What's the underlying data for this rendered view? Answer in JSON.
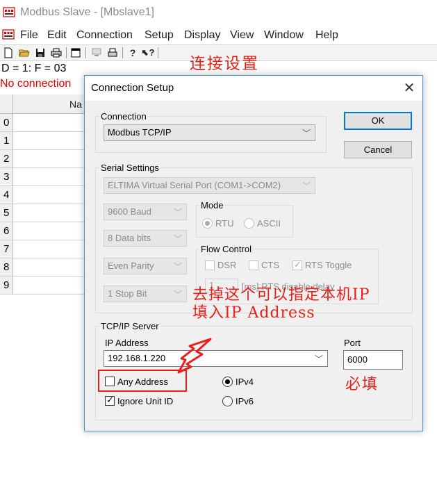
{
  "app": {
    "title": "Modbus Slave - [Mbslave1]",
    "menu": [
      "File",
      "Edit",
      "Connection",
      "Setup",
      "Display",
      "View",
      "Window",
      "Help"
    ],
    "toolbar_icons": [
      "new-icon",
      "open-icon",
      "save-icon",
      "print-icon",
      "window-icon",
      "monitor-icon",
      "printer2-icon",
      "help-icon",
      "context-help-icon"
    ],
    "status_line": "D = 1: F = 03",
    "no_connection": "No connection",
    "grid": {
      "column_header": "Na",
      "rows": [
        "0",
        "1",
        "2",
        "3",
        "4",
        "5",
        "6",
        "7",
        "8",
        "9"
      ]
    }
  },
  "annotations": {
    "title": "连接设置",
    "ip_note_line1": "去掉这个可以指定本机IP",
    "ip_note_line2": "填入IP Address",
    "port_note": "必填"
  },
  "dialog": {
    "title": "Connection Setup",
    "close_glyph": "✕",
    "buttons": {
      "ok": "OK",
      "cancel": "Cancel"
    },
    "connection": {
      "label": "Connection",
      "value": "Modbus TCP/IP"
    },
    "serial": {
      "label": "Serial Settings",
      "port": "ELTIMA Virtual Serial Port (COM1->COM2)",
      "baud": "9600 Baud",
      "data_bits": "8 Data bits",
      "parity": "Even Parity",
      "stop_bits": "1 Stop Bit",
      "mode": {
        "label": "Mode",
        "rtu": "RTU",
        "ascii": "ASCII",
        "selected": "RTU"
      },
      "flow": {
        "label": "Flow Control",
        "dsr": "DSR",
        "cts": "CTS",
        "rts_toggle": "RTS Toggle",
        "rts_toggle_checked": true,
        "rts_delay_value": "1",
        "rts_delay_label": "[ms] RTS disable delay"
      }
    },
    "tcp": {
      "label": "TCP/IP Server",
      "ip_label": "IP Address",
      "ip_value": "192.168.1.220",
      "port_label": "Port",
      "port_value": "6000",
      "any_address": "Any Address",
      "any_address_checked": false,
      "ignore_unit_id": "Ignore Unit ID",
      "ignore_unit_id_checked": true,
      "ipv4": "IPv4",
      "ipv6": "IPv6",
      "ip_version_selected": "IPv4"
    }
  },
  "colors": {
    "annotation_red": "#e8201a",
    "status_red": "#e00000",
    "dialog_border": "#4a90d0",
    "default_button_border": "#0078d7"
  }
}
